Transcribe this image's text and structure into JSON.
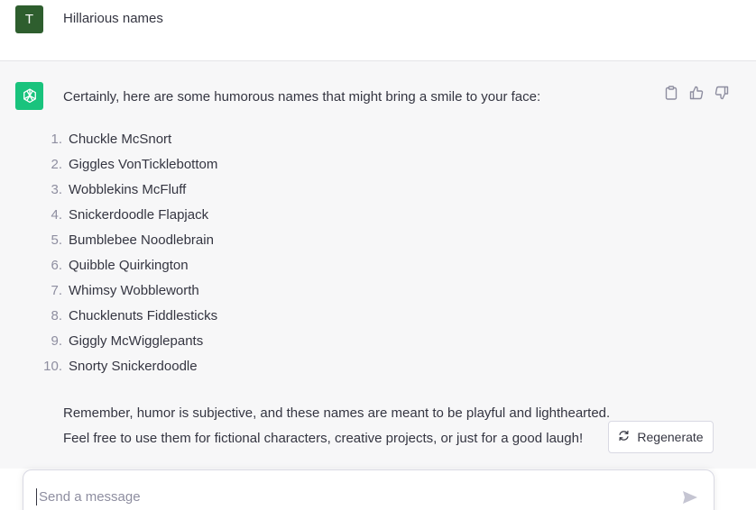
{
  "user_message": {
    "avatar_letter": "T",
    "text": "Hillarious names"
  },
  "assistant_message": {
    "intro": "Certainly, here are some humorous names that might bring a smile to your face:",
    "names": [
      {
        "num": "1.",
        "name": "Chuckle McSnort"
      },
      {
        "num": "2.",
        "name": "Giggles VonTicklebottom"
      },
      {
        "num": "3.",
        "name": "Wobblekins McFluff"
      },
      {
        "num": "4.",
        "name": "Snickerdoodle Flapjack"
      },
      {
        "num": "5.",
        "name": "Bumblebee Noodlebrain"
      },
      {
        "num": "6.",
        "name": "Quibble Quirkington"
      },
      {
        "num": "7.",
        "name": "Whimsy Wobbleworth"
      },
      {
        "num": "8.",
        "name": "Chucklenuts Fiddlesticks"
      },
      {
        "num": "9.",
        "name": "Giggly McWigglepants"
      },
      {
        "num": "10.",
        "name": "Snorty Snickerdoodle"
      }
    ],
    "closing_line1": "Remember, humor is subjective, and these names are meant to be playful and lighthearted.",
    "closing_line2": "Feel free to use them for fictional characters, creative projects, or just for a good laugh!",
    "actions": [
      "clipboard-icon",
      "thumbs-up-icon",
      "thumbs-down-icon"
    ]
  },
  "regenerate": {
    "label": "Regenerate",
    "icon": "refresh-icon"
  },
  "composer": {
    "placeholder": "Send a message",
    "send_icon": "send-icon"
  },
  "colors": {
    "user_avatar": "#2e5e2e",
    "bot_avatar": "#19c37d",
    "assistant_bg": "#f7f7f8",
    "text": "#343541",
    "muted": "#8e8ea0"
  }
}
